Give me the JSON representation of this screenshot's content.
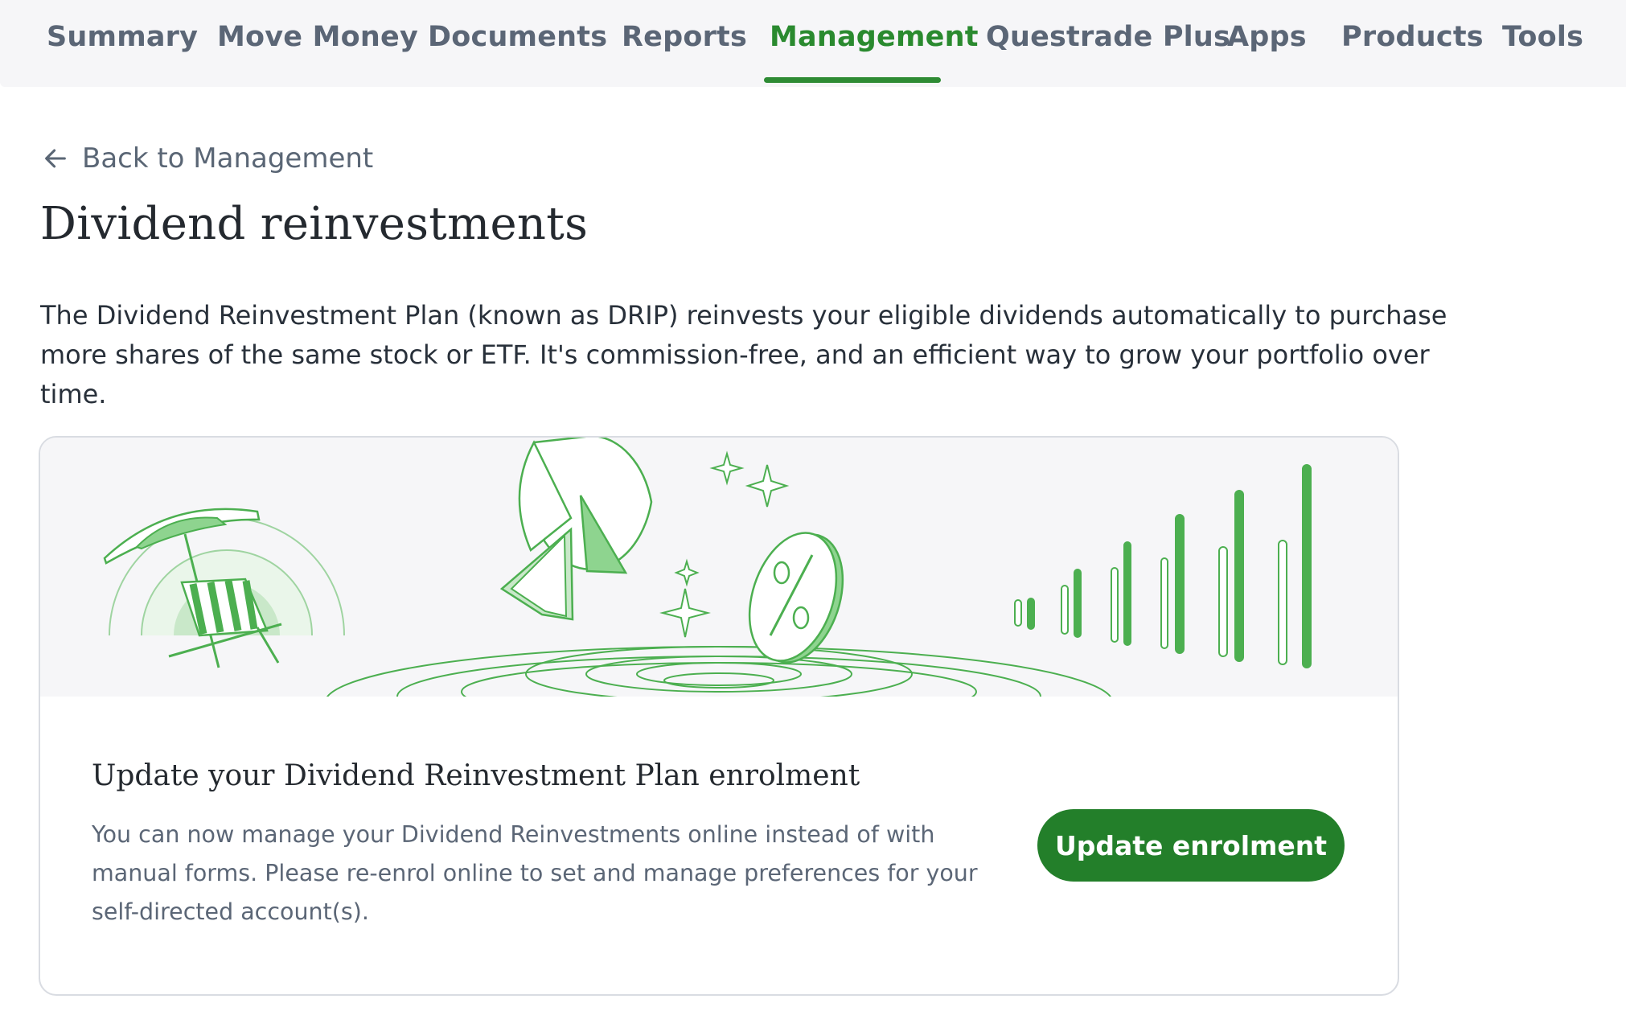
{
  "nav": {
    "tabs": [
      {
        "label": "Summary"
      },
      {
        "label": "Move Money"
      },
      {
        "label": "Documents"
      },
      {
        "label": "Reports"
      },
      {
        "label": "Management"
      },
      {
        "label": "Questrade Plus"
      },
      {
        "label": "Apps"
      },
      {
        "label": "Products"
      },
      {
        "label": "Tools"
      }
    ],
    "active": "Management"
  },
  "back_link": {
    "label": "Back to Management",
    "icon": "arrow-left-icon"
  },
  "page": {
    "title": "Dividend reinvestments",
    "intro": "The Dividend Reinvestment Plan (known as DRIP) reinvests your eligible dividends automatically to purchase more shares of the same stock or ETF. It's commission-free, and an efficient way to grow your portfolio over time."
  },
  "card": {
    "title": "Update your Dividend Reinvestment Plan enrolment",
    "body": "You can now manage your Dividend Reinvestments online instead of with manual forms. Please re-enrol online to set and manage preferences for your self-directed account(s).",
    "button_label": "Update enrolment"
  },
  "colors": {
    "brand_green": "#237f2a",
    "active_tab": "#2a8a2f",
    "nav_text": "#5b6676",
    "illustration_bg": "#f6f6f8"
  }
}
